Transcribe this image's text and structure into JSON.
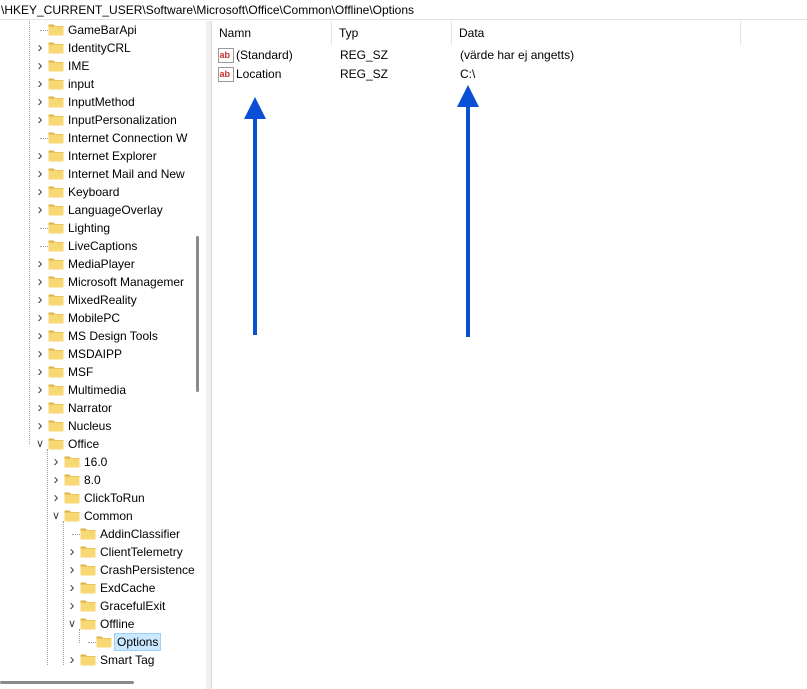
{
  "address": {
    "path": "\\HKEY_CURRENT_USER\\Software\\Microsoft\\Office\\Common\\Offline\\Options"
  },
  "tree": {
    "items": [
      {
        "label": "GameBarApi",
        "expander": "none",
        "depth": 0
      },
      {
        "label": "IdentityCRL",
        "expander": "collapsed",
        "depth": 0
      },
      {
        "label": "IME",
        "expander": "collapsed",
        "depth": 0
      },
      {
        "label": "input",
        "expander": "collapsed",
        "depth": 0
      },
      {
        "label": "InputMethod",
        "expander": "collapsed",
        "depth": 0
      },
      {
        "label": "InputPersonalization",
        "expander": "collapsed",
        "depth": 0
      },
      {
        "label": "Internet Connection W",
        "expander": "none",
        "depth": 0
      },
      {
        "label": "Internet Explorer",
        "expander": "collapsed",
        "depth": 0
      },
      {
        "label": "Internet Mail and New",
        "expander": "collapsed",
        "depth": 0
      },
      {
        "label": "Keyboard",
        "expander": "collapsed",
        "depth": 0
      },
      {
        "label": "LanguageOverlay",
        "expander": "collapsed",
        "depth": 0
      },
      {
        "label": "Lighting",
        "expander": "none",
        "depth": 0
      },
      {
        "label": "LiveCaptions",
        "expander": "none",
        "depth": 0
      },
      {
        "label": "MediaPlayer",
        "expander": "collapsed",
        "depth": 0
      },
      {
        "label": "Microsoft Managemer",
        "expander": "collapsed",
        "depth": 0
      },
      {
        "label": "MixedReality",
        "expander": "collapsed",
        "depth": 0
      },
      {
        "label": "MobilePC",
        "expander": "collapsed",
        "depth": 0
      },
      {
        "label": "MS Design Tools",
        "expander": "collapsed",
        "depth": 0
      },
      {
        "label": "MSDAIPP",
        "expander": "collapsed",
        "depth": 0
      },
      {
        "label": "MSF",
        "expander": "collapsed",
        "depth": 0
      },
      {
        "label": "Multimedia",
        "expander": "collapsed",
        "depth": 0
      },
      {
        "label": "Narrator",
        "expander": "collapsed",
        "depth": 0
      },
      {
        "label": "Nucleus",
        "expander": "collapsed",
        "depth": 0
      },
      {
        "label": "Office",
        "expander": "expanded",
        "depth": 0
      },
      {
        "label": "16.0",
        "expander": "collapsed",
        "depth": 1
      },
      {
        "label": "8.0",
        "expander": "collapsed",
        "depth": 1
      },
      {
        "label": "ClickToRun",
        "expander": "collapsed",
        "depth": 1
      },
      {
        "label": "Common",
        "expander": "expanded",
        "depth": 1
      },
      {
        "label": "AddinClassifier",
        "expander": "none",
        "depth": 2
      },
      {
        "label": "ClientTelemetry",
        "expander": "collapsed",
        "depth": 2
      },
      {
        "label": "CrashPersistence",
        "expander": "collapsed",
        "depth": 2
      },
      {
        "label": "ExdCache",
        "expander": "collapsed",
        "depth": 2
      },
      {
        "label": "GracefulExit",
        "expander": "collapsed",
        "depth": 2
      },
      {
        "label": "Offline",
        "expander": "expanded",
        "depth": 2
      },
      {
        "label": "Options",
        "expander": "none",
        "depth": 3,
        "selected": true
      },
      {
        "label": "Smart Tag",
        "expander": "collapsed",
        "depth": 2
      }
    ]
  },
  "list": {
    "columns": [
      {
        "label": "Namn"
      },
      {
        "label": "Typ"
      },
      {
        "label": "Data"
      }
    ],
    "rows": [
      {
        "name": "(Standard)",
        "type": "REG_SZ",
        "data": "(värde har ej angetts)",
        "icon": "string-value-icon"
      },
      {
        "name": "Location",
        "type": "REG_SZ",
        "data": "C:\\",
        "icon": "string-value-icon"
      }
    ]
  },
  "colors": {
    "folder": "#f8d775",
    "folder_dark": "#e0b341",
    "selection_bg": "#cce8ff",
    "selection_border": "#99d1ff",
    "arrow": "#0a4fd6",
    "ab_icon": "#c8312f"
  }
}
